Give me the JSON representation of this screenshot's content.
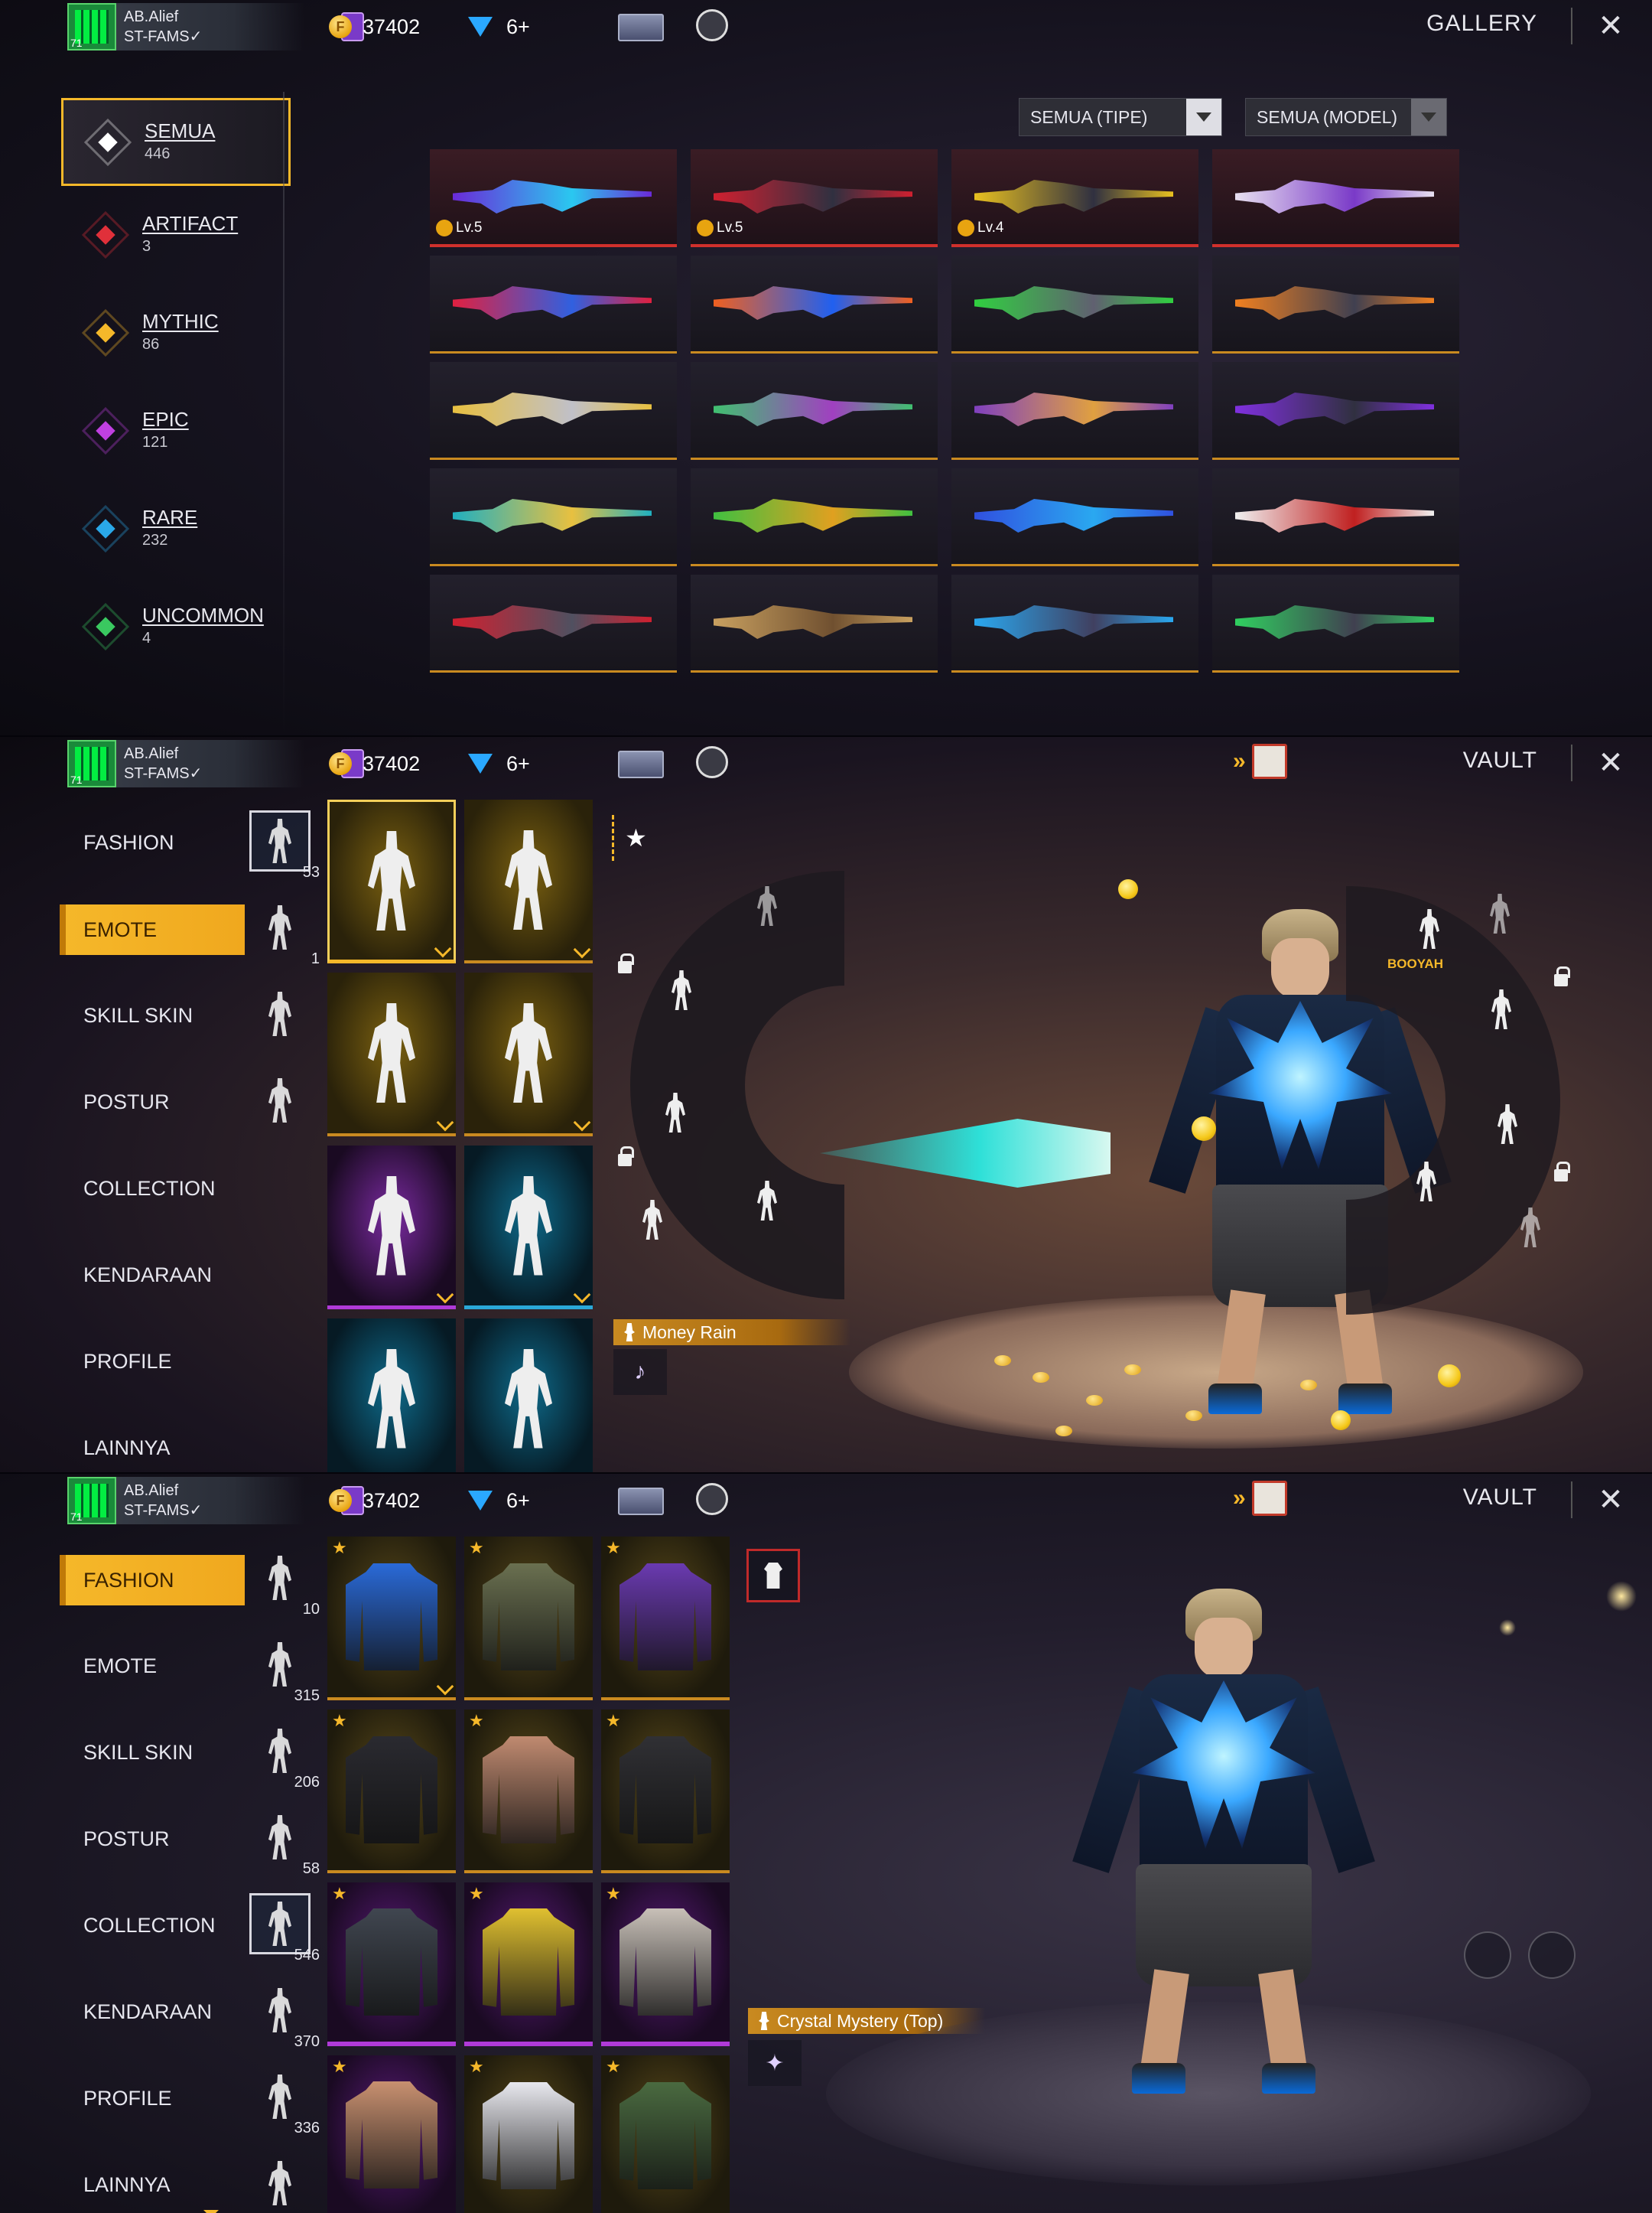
{
  "profile": {
    "name": "AB.Alief",
    "guild": "ST-FAMS✓",
    "level": "71"
  },
  "resources": {
    "gold": "37402",
    "diamonds": "6+"
  },
  "gallery": {
    "title": "GALLERY",
    "filter_type": "SEMUA (TIPE)",
    "filter_model": "SEMUA (MODEL)",
    "categories": [
      {
        "name": "SEMUA",
        "count": "446",
        "color": "#ffffff"
      },
      {
        "name": "ARTIFACT",
        "count": "3",
        "color": "#e0303a"
      },
      {
        "name": "MYTHIC",
        "count": "86",
        "color": "#f5b82a"
      },
      {
        "name": "EPIC",
        "count": "121",
        "color": "#c040e0"
      },
      {
        "name": "RARE",
        "count": "232",
        "color": "#2aa8e8"
      },
      {
        "name": "UNCOMMON",
        "count": "4",
        "color": "#3ac860"
      }
    ],
    "items": [
      {
        "level": "Lv.5",
        "rarity": "red",
        "colors": [
          "#6a2ad8",
          "#2ac8f0"
        ]
      },
      {
        "level": "Lv.5",
        "rarity": "red",
        "colors": [
          "#d02030",
          "#303040"
        ]
      },
      {
        "level": "Lv.4",
        "rarity": "red",
        "colors": [
          "#e8c020",
          "#303040"
        ]
      },
      {
        "level": "",
        "rarity": "red",
        "colors": [
          "#e8e0f0",
          "#7a3ac8"
        ]
      },
      {
        "level": "",
        "rarity": "gold",
        "colors": [
          "#e02040",
          "#3060e0"
        ]
      },
      {
        "level": "",
        "rarity": "gold",
        "colors": [
          "#f06020",
          "#2060f0"
        ]
      },
      {
        "level": "",
        "rarity": "gold",
        "colors": [
          "#30d040",
          "#606070"
        ]
      },
      {
        "level": "",
        "rarity": "gold",
        "colors": [
          "#f08020",
          "#404050"
        ]
      },
      {
        "level": "",
        "rarity": "gold",
        "colors": [
          "#e8c040",
          "#c0c0c8"
        ]
      },
      {
        "level": "",
        "rarity": "gold",
        "colors": [
          "#40c070",
          "#a040c0"
        ]
      },
      {
        "level": "",
        "rarity": "gold",
        "colors": [
          "#8040c0",
          "#e0a040"
        ]
      },
      {
        "level": "",
        "rarity": "gold",
        "colors": [
          "#8030e0",
          "#303040"
        ]
      },
      {
        "level": "",
        "rarity": "gold",
        "colors": [
          "#20b0c0",
          "#e8c040"
        ]
      },
      {
        "level": "",
        "rarity": "gold",
        "colors": [
          "#40c040",
          "#e0a020"
        ]
      },
      {
        "level": "",
        "rarity": "gold",
        "colors": [
          "#3050e0",
          "#2aa8f0"
        ]
      },
      {
        "level": "",
        "rarity": "gold",
        "colors": [
          "#f0f0f0",
          "#c02020"
        ]
      },
      {
        "level": "",
        "rarity": "gold",
        "colors": [
          "#d02030",
          "#505060"
        ]
      },
      {
        "level": "",
        "rarity": "gold",
        "colors": [
          "#c8a060",
          "#705030"
        ]
      },
      {
        "level": "",
        "rarity": "gold",
        "colors": [
          "#2aa8f0",
          "#404060"
        ]
      },
      {
        "level": "",
        "rarity": "gold",
        "colors": [
          "#30d060",
          "#404050"
        ]
      }
    ]
  },
  "vault": {
    "title": "VAULT",
    "nav": [
      "FASHION",
      "EMOTE",
      "SKILL SKIN",
      "POSTUR",
      "COLLECTION",
      "KENDARAAN",
      "PROFILE",
      "LAINNYA"
    ],
    "emote_tab": {
      "active": "EMOTE",
      "counts": [
        "53",
        "1",
        "",
        "",
        "",
        "",
        "",
        ""
      ],
      "selected_label": "Money Rain",
      "wheel_label": "BOOYAH"
    },
    "fashion_tab": {
      "active": "FASHION",
      "counts": [
        "10",
        "315",
        "206",
        "58",
        "546",
        "370",
        "336",
        ""
      ],
      "selected_label": "Crystal Mystery (Top)",
      "items": [
        {
          "color": "#2a6ad8",
          "rarity": "gold"
        },
        {
          "color": "#6a7050",
          "rarity": "gold"
        },
        {
          "color": "#6a3ab0",
          "rarity": "gold"
        },
        {
          "color": "#2a2a30",
          "rarity": "gold"
        },
        {
          "color": "#c08a70",
          "rarity": "gold"
        },
        {
          "color": "#303034",
          "rarity": "gold"
        },
        {
          "color": "#404650",
          "rarity": "purple"
        },
        {
          "color": "#e0c030",
          "rarity": "purple"
        },
        {
          "color": "#c8c0b8",
          "rarity": "purple"
        },
        {
          "color": "#c89070",
          "rarity": "purple"
        },
        {
          "color": "#e8e8ee",
          "rarity": "gold"
        },
        {
          "color": "#4a6a40",
          "rarity": "gold"
        }
      ]
    }
  }
}
